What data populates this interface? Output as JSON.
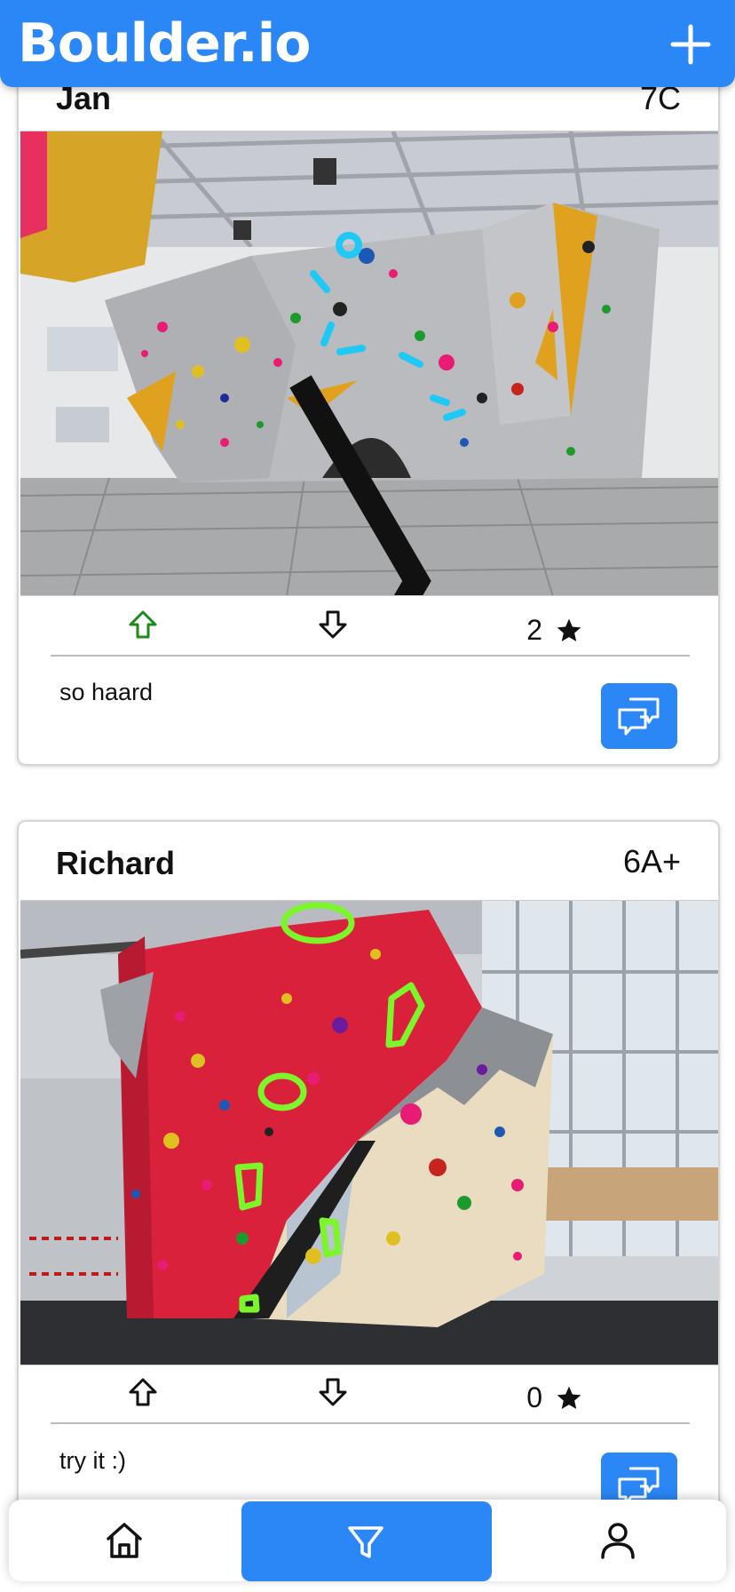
{
  "app": {
    "title": "Boulder.io"
  },
  "posts": [
    {
      "author": "Jan",
      "grade": "7C",
      "rating": "2",
      "comment": "so haard",
      "upvote_active": true
    },
    {
      "author": "Richard",
      "grade": "6A+",
      "rating": "0",
      "comment": "try it :)",
      "upvote_active": false
    }
  ],
  "icons": {
    "add": "plus-icon",
    "upvote": "arrow-up-icon",
    "downvote": "arrow-down-icon",
    "rating": "star-icon",
    "comments": "chat-bubbles-icon",
    "next": "chevron-right-icon",
    "home": "home-icon",
    "filter": "filter-icon",
    "profile": "user-icon"
  },
  "colors": {
    "accent": "#2b87f5",
    "upvote_active": "#1a8a1a",
    "route_highlight_1": "#1fc8f5",
    "route_highlight_2": "#7cf52a"
  }
}
